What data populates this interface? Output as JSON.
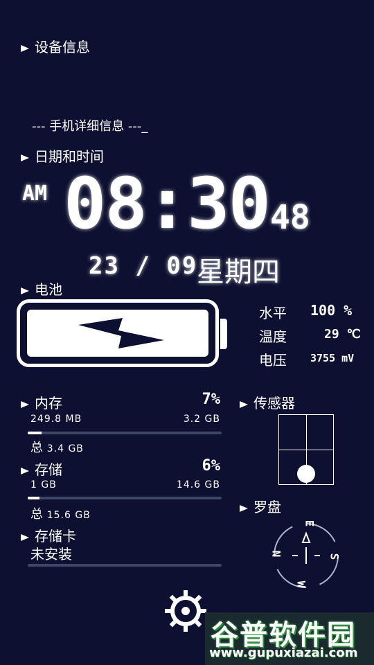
{
  "sections": {
    "device_info": "设备信息",
    "phone_details": "--- 手机详细信息 ---_",
    "datetime": "日期和时间",
    "battery": "电池",
    "memory": "内存",
    "storage": "存储",
    "sdcard": "存储卡",
    "sensor": "传感器",
    "compass": "罗盘"
  },
  "clock": {
    "ampm": "AM",
    "time": "08:30",
    "seconds": "48",
    "date": "23 / 09",
    "weekday": "星期四"
  },
  "battery": {
    "level_label": "水平",
    "level_value": "100 %",
    "temp_label": "温度",
    "temp_value": "29 ℃",
    "voltage_label": "电压",
    "voltage_value": "3755 mV",
    "icon": "lightning-icon"
  },
  "memory": {
    "percent": "7%",
    "used": "249.8 MB",
    "free": "3.2 GB",
    "total_label": "总",
    "total": "3.4 GB",
    "fraction": 0.07
  },
  "storage": {
    "percent": "6%",
    "used": "1 GB",
    "free": "14.6 GB",
    "total_label": "总",
    "total": "15.6 GB",
    "fraction": 0.06
  },
  "sdcard": {
    "status": "未安装",
    "fraction": 0
  },
  "compass": {
    "n": "N",
    "e": "E",
    "s": "S",
    "w": "W"
  },
  "watermark": {
    "brand": "谷普软件园",
    "url": "www.gupuxiazai.com"
  },
  "colors": {
    "background": "#0d1030",
    "bar_track": "#3d4663",
    "foreground": "#ffffff"
  }
}
